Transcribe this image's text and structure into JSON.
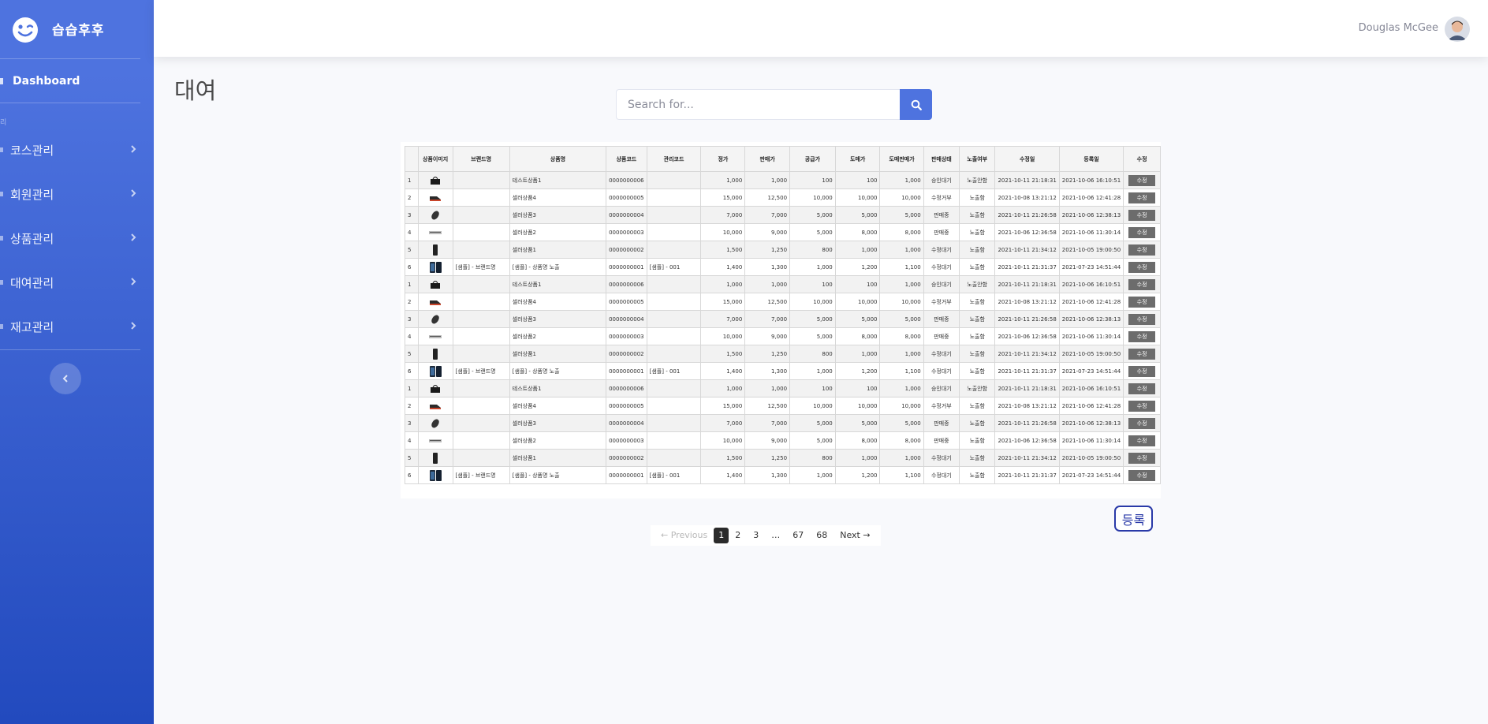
{
  "brand": {
    "name": "습습후후"
  },
  "sidebar": {
    "dashboard_label": "Dashboard",
    "section_heading": "리",
    "items": [
      {
        "label": "코스관리"
      },
      {
        "label": "회원관리"
      },
      {
        "label": "상품관리"
      },
      {
        "label": "대여관리"
      },
      {
        "label": "재고관리"
      }
    ]
  },
  "topbar": {
    "user_name": "Douglas McGee"
  },
  "page": {
    "title": "대여"
  },
  "search": {
    "placeholder": "Search for..."
  },
  "table": {
    "headers": [
      "",
      "상품이미지",
      "브랜드명",
      "상품명",
      "상품코드",
      "관리코드",
      "정가",
      "판매가",
      "공급가",
      "도매가",
      "도매판매가",
      "판매상태",
      "노출여부",
      "수정일",
      "등록일",
      "수정"
    ],
    "edit_label": "수정",
    "rows": [
      {
        "no": "1",
        "thumb": "bag",
        "brand": "",
        "name": "테스트상품1",
        "code": "0000000006",
        "mgmt": "",
        "list": "1,000",
        "sale": "1,000",
        "supply": "100",
        "whole": "100",
        "wsale": "1,000",
        "status": "승인대기",
        "expose": "노출안함",
        "updated": "2021-10-11 21:18:31",
        "created": "2021-10-06 16:10:51"
      },
      {
        "no": "2",
        "thumb": "shoe",
        "brand": "",
        "name": "셀러상품4",
        "code": "0000000005",
        "mgmt": "",
        "list": "15,000",
        "sale": "12,500",
        "supply": "10,000",
        "whole": "10,000",
        "wsale": "10,000",
        "status": "수정거부",
        "expose": "노출함",
        "updated": "2021-10-08 13:21:12",
        "created": "2021-10-06 12:41:28"
      },
      {
        "no": "3",
        "thumb": "mouse",
        "brand": "",
        "name": "셀러상품3",
        "code": "0000000004",
        "mgmt": "",
        "list": "7,000",
        "sale": "7,000",
        "supply": "5,000",
        "whole": "5,000",
        "wsale": "5,000",
        "status": "판매중",
        "expose": "노출함",
        "updated": "2021-10-11 21:26:58",
        "created": "2021-10-06 12:38:13"
      },
      {
        "no": "4",
        "thumb": "keyboard",
        "brand": "",
        "name": "셀러상품2",
        "code": "0000000003",
        "mgmt": "",
        "list": "10,000",
        "sale": "9,000",
        "supply": "5,000",
        "whole": "8,000",
        "wsale": "8,000",
        "status": "판매중",
        "expose": "노출함",
        "updated": "2021-10-06 12:36:58",
        "created": "2021-10-06 11:30:14"
      },
      {
        "no": "5",
        "thumb": "phone",
        "brand": "",
        "name": "셀러상품1",
        "code": "0000000002",
        "mgmt": "",
        "list": "1,500",
        "sale": "1,250",
        "supply": "800",
        "whole": "1,000",
        "wsale": "1,000",
        "status": "수정대기",
        "expose": "노출함",
        "updated": "2021-10-11 21:34:12",
        "created": "2021-10-05 19:00:50"
      },
      {
        "no": "6",
        "thumb": "phones",
        "brand": "[샘플] - 브랜드명",
        "name": "[샘플] - 상품명 노출",
        "code": "0000000001",
        "mgmt": "[샘플] - 001",
        "list": "1,400",
        "sale": "1,300",
        "supply": "1,000",
        "whole": "1,200",
        "wsale": "1,100",
        "status": "수정대기",
        "expose": "노출함",
        "updated": "2021-10-11 21:31:37",
        "created": "2021-07-23 14:51:44"
      },
      {
        "no": "1",
        "thumb": "bag",
        "brand": "",
        "name": "테스트상품1",
        "code": "0000000006",
        "mgmt": "",
        "list": "1,000",
        "sale": "1,000",
        "supply": "100",
        "whole": "100",
        "wsale": "1,000",
        "status": "승인대기",
        "expose": "노출안함",
        "updated": "2021-10-11 21:18:31",
        "created": "2021-10-06 16:10:51"
      },
      {
        "no": "2",
        "thumb": "shoe",
        "brand": "",
        "name": "셀러상품4",
        "code": "0000000005",
        "mgmt": "",
        "list": "15,000",
        "sale": "12,500",
        "supply": "10,000",
        "whole": "10,000",
        "wsale": "10,000",
        "status": "수정거부",
        "expose": "노출함",
        "updated": "2021-10-08 13:21:12",
        "created": "2021-10-06 12:41:28"
      },
      {
        "no": "3",
        "thumb": "mouse",
        "brand": "",
        "name": "셀러상품3",
        "code": "0000000004",
        "mgmt": "",
        "list": "7,000",
        "sale": "7,000",
        "supply": "5,000",
        "whole": "5,000",
        "wsale": "5,000",
        "status": "판매중",
        "expose": "노출함",
        "updated": "2021-10-11 21:26:58",
        "created": "2021-10-06 12:38:13"
      },
      {
        "no": "4",
        "thumb": "keyboard",
        "brand": "",
        "name": "셀러상품2",
        "code": "0000000003",
        "mgmt": "",
        "list": "10,000",
        "sale": "9,000",
        "supply": "5,000",
        "whole": "8,000",
        "wsale": "8,000",
        "status": "판매중",
        "expose": "노출함",
        "updated": "2021-10-06 12:36:58",
        "created": "2021-10-06 11:30:14"
      },
      {
        "no": "5",
        "thumb": "phone",
        "brand": "",
        "name": "셀러상품1",
        "code": "0000000002",
        "mgmt": "",
        "list": "1,500",
        "sale": "1,250",
        "supply": "800",
        "whole": "1,000",
        "wsale": "1,000",
        "status": "수정대기",
        "expose": "노출함",
        "updated": "2021-10-11 21:34:12",
        "created": "2021-10-05 19:00:50"
      },
      {
        "no": "6",
        "thumb": "phones",
        "brand": "[샘플] - 브랜드명",
        "name": "[샘플] - 상품명 노출",
        "code": "0000000001",
        "mgmt": "[샘플] - 001",
        "list": "1,400",
        "sale": "1,300",
        "supply": "1,000",
        "whole": "1,200",
        "wsale": "1,100",
        "status": "수정대기",
        "expose": "노출함",
        "updated": "2021-10-11 21:31:37",
        "created": "2021-07-23 14:51:44"
      },
      {
        "no": "1",
        "thumb": "bag",
        "brand": "",
        "name": "테스트상품1",
        "code": "0000000006",
        "mgmt": "",
        "list": "1,000",
        "sale": "1,000",
        "supply": "100",
        "whole": "100",
        "wsale": "1,000",
        "status": "승인대기",
        "expose": "노출안함",
        "updated": "2021-10-11 21:18:31",
        "created": "2021-10-06 16:10:51"
      },
      {
        "no": "2",
        "thumb": "shoe",
        "brand": "",
        "name": "셀러상품4",
        "code": "0000000005",
        "mgmt": "",
        "list": "15,000",
        "sale": "12,500",
        "supply": "10,000",
        "whole": "10,000",
        "wsale": "10,000",
        "status": "수정거부",
        "expose": "노출함",
        "updated": "2021-10-08 13:21:12",
        "created": "2021-10-06 12:41:28"
      },
      {
        "no": "3",
        "thumb": "mouse",
        "brand": "",
        "name": "셀러상품3",
        "code": "0000000004",
        "mgmt": "",
        "list": "7,000",
        "sale": "7,000",
        "supply": "5,000",
        "whole": "5,000",
        "wsale": "5,000",
        "status": "판매중",
        "expose": "노출함",
        "updated": "2021-10-11 21:26:58",
        "created": "2021-10-06 12:38:13"
      },
      {
        "no": "4",
        "thumb": "keyboard",
        "brand": "",
        "name": "셀러상품2",
        "code": "0000000003",
        "mgmt": "",
        "list": "10,000",
        "sale": "9,000",
        "supply": "5,000",
        "whole": "8,000",
        "wsale": "8,000",
        "status": "판매중",
        "expose": "노출함",
        "updated": "2021-10-06 12:36:58",
        "created": "2021-10-06 11:30:14"
      },
      {
        "no": "5",
        "thumb": "phone",
        "brand": "",
        "name": "셀러상품1",
        "code": "0000000002",
        "mgmt": "",
        "list": "1,500",
        "sale": "1,250",
        "supply": "800",
        "whole": "1,000",
        "wsale": "1,000",
        "status": "수정대기",
        "expose": "노출함",
        "updated": "2021-10-11 21:34:12",
        "created": "2021-10-05 19:00:50"
      },
      {
        "no": "6",
        "thumb": "phones",
        "brand": "[샘플] - 브랜드명",
        "name": "[샘플] - 상품명 노출",
        "code": "0000000001",
        "mgmt": "[샘플] - 001",
        "list": "1,400",
        "sale": "1,300",
        "supply": "1,000",
        "whole": "1,200",
        "wsale": "1,100",
        "status": "수정대기",
        "expose": "노출함",
        "updated": "2021-10-11 21:31:37",
        "created": "2021-07-23 14:51:44"
      }
    ]
  },
  "actions": {
    "register_label": "등록"
  },
  "pagination": {
    "previous": "Previous",
    "next": "Next",
    "pages": [
      "1",
      "2",
      "3",
      "…",
      "67",
      "68"
    ],
    "current": "1"
  }
}
